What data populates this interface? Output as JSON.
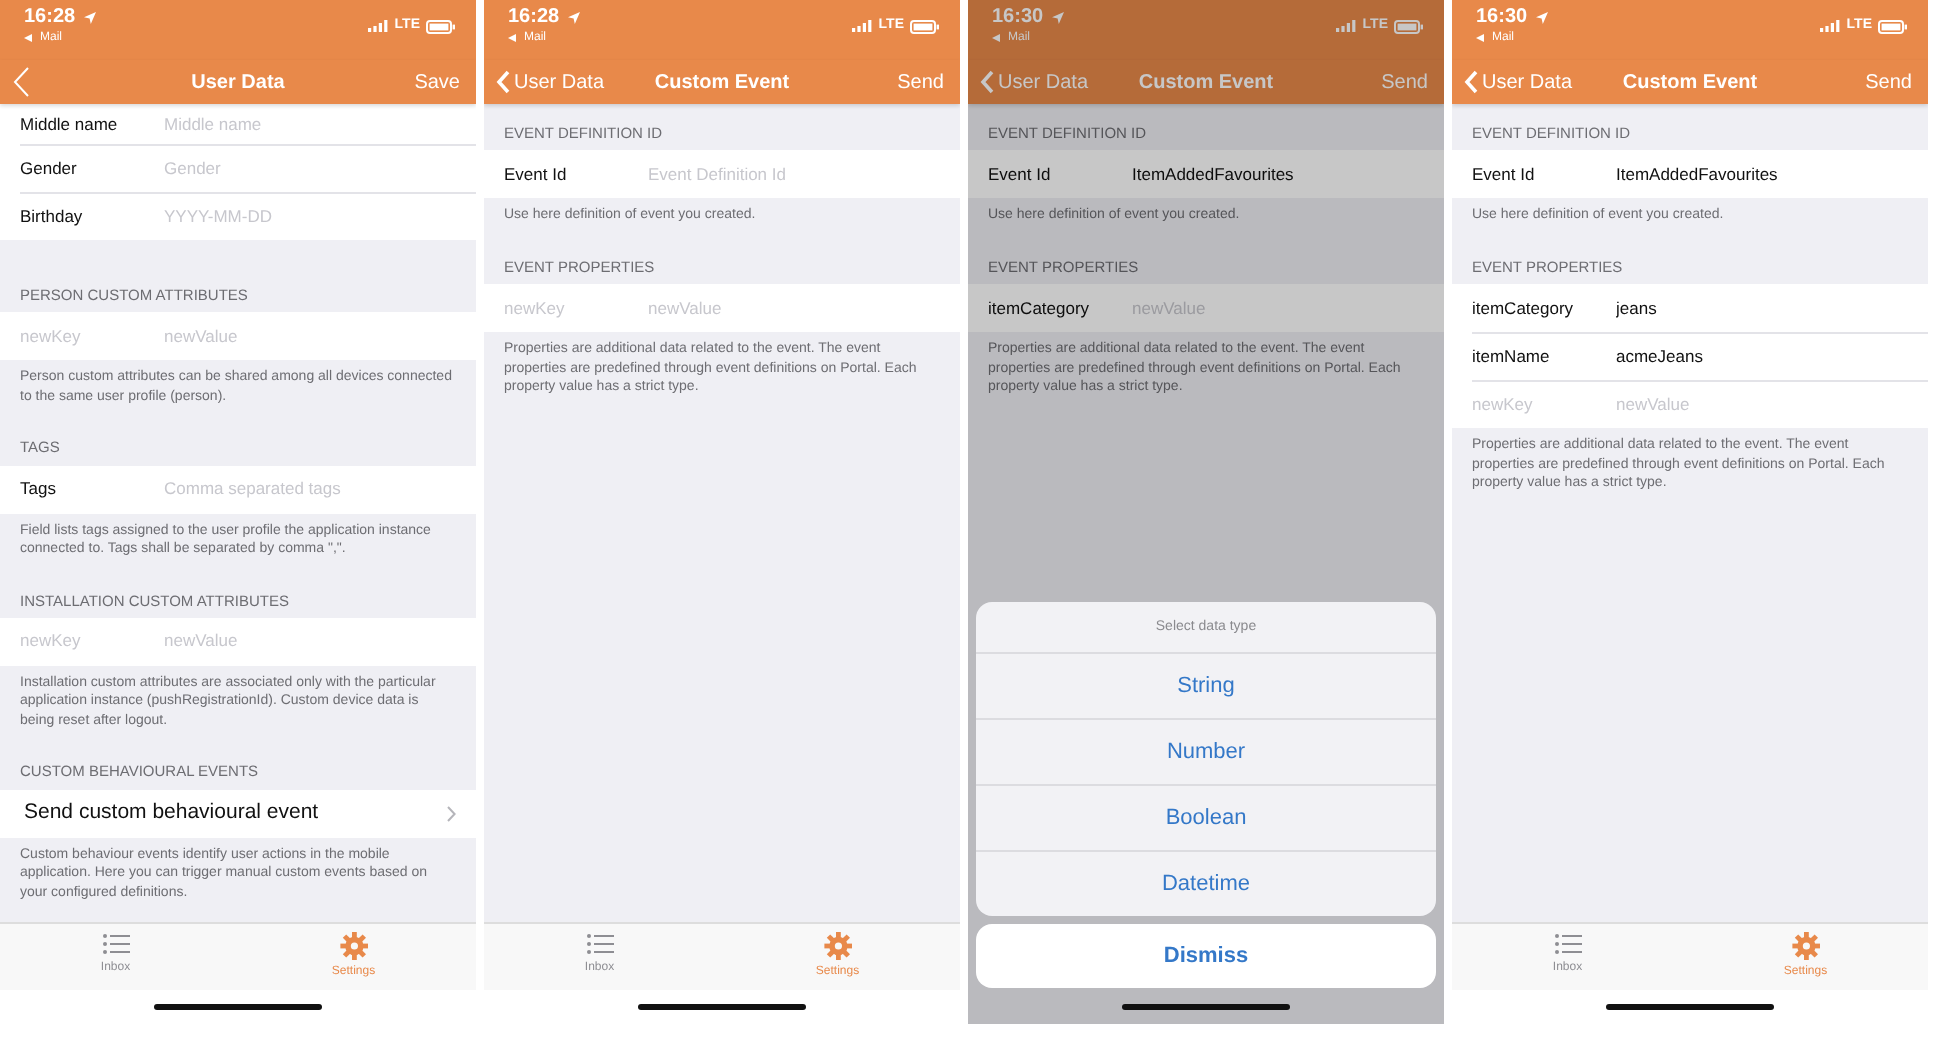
{
  "screens": [
    {
      "status_bar": {
        "time": "16:28",
        "back_app": "Mail",
        "network": "LTE"
      },
      "nav": {
        "title": "User Data",
        "action": "Save"
      },
      "sections": [
        {
          "kind": "field",
          "label": "Middle name",
          "placeholder": "Middle name"
        },
        {
          "kind": "field",
          "label": "Gender",
          "placeholder": "Gender"
        },
        {
          "kind": "field",
          "label": "Birthday",
          "placeholder": "YYYY-MM-DD"
        },
        {
          "kind": "header",
          "text": "PERSON CUSTOM ATTRIBUTES"
        },
        {
          "kind": "pair",
          "key_placeholder": "newKey",
          "placeholder": "newValue"
        },
        {
          "kind": "footer",
          "text": "Person custom attributes can be shared among all devices connected to the same user profile (person)."
        },
        {
          "kind": "header",
          "text": "TAGS"
        },
        {
          "kind": "field",
          "label": "Tags",
          "placeholder": "Comma separated tags"
        },
        {
          "kind": "footer",
          "text": "Field lists tags assigned to the user profile the application instance connected to. Tags shall be separated by comma \",\"."
        },
        {
          "kind": "header",
          "text": "INSTALLATION CUSTOM ATTRIBUTES"
        },
        {
          "kind": "pair",
          "key_placeholder": "newKey",
          "placeholder": "newValue"
        },
        {
          "kind": "footer",
          "text": "Installation custom attributes are associated only with the particular application instance (pushRegistrationId). Custom device data is being reset after logout."
        },
        {
          "kind": "header",
          "text": "CUSTOM BEHAVIOURAL EVENTS"
        },
        {
          "kind": "link",
          "label": "Send custom behavioural event"
        },
        {
          "kind": "footer",
          "text": "Custom behaviour events identify user actions in the mobile application. Here you can trigger manual custom events based on your configured definitions."
        }
      ],
      "tab_bar": [
        {
          "label": "Inbox",
          "selected": false
        },
        {
          "label": "Settings",
          "selected": true
        }
      ]
    },
    {
      "status_bar": {
        "time": "16:28",
        "back_app": "Mail",
        "network": "LTE"
      },
      "nav": {
        "back_label": "User Data",
        "title": "Custom Event",
        "action": "Send"
      },
      "sections": [
        {
          "kind": "header",
          "text": "EVENT DEFINITION ID"
        },
        {
          "kind": "field",
          "label": "Event Id",
          "placeholder": "Event Definition Id"
        },
        {
          "kind": "footer",
          "text": "Use here definition of event you created."
        },
        {
          "kind": "header",
          "text": "EVENT PROPERTIES"
        },
        {
          "kind": "pair",
          "key_placeholder": "newKey",
          "placeholder": "newValue"
        },
        {
          "kind": "footer",
          "text": "Properties are additional data related to the event. The event properties are predefined through event definitions on Portal. Each property value has a strict type."
        }
      ],
      "tab_bar": [
        {
          "label": "Inbox",
          "selected": false
        },
        {
          "label": "Settings",
          "selected": true
        }
      ]
    },
    {
      "status_bar": {
        "time": "16:30",
        "back_app": "Mail",
        "network": "LTE"
      },
      "nav": {
        "back_label": "User Data",
        "title": "Custom Event",
        "action": "Send"
      },
      "sections": [
        {
          "kind": "header",
          "text": "EVENT DEFINITION ID"
        },
        {
          "kind": "field",
          "label": "Event Id",
          "value": "ItemAddedFavourites"
        },
        {
          "kind": "footer",
          "text": "Use here definition of event you created."
        },
        {
          "kind": "header",
          "text": "EVENT PROPERTIES"
        },
        {
          "kind": "pair",
          "key": "itemCategory",
          "placeholder": "newValue"
        },
        {
          "kind": "footer",
          "text": "Properties are additional data related to the event. The event properties are predefined through event definitions on Portal. Each property value has a strict type."
        }
      ],
      "action_sheet": {
        "title": "Select data type",
        "options": [
          "String",
          "Number",
          "Boolean",
          "Datetime"
        ],
        "cancel": "Dismiss"
      }
    },
    {
      "status_bar": {
        "time": "16:30",
        "back_app": "Mail",
        "network": "LTE"
      },
      "nav": {
        "back_label": "User Data",
        "title": "Custom Event",
        "action": "Send"
      },
      "sections": [
        {
          "kind": "header",
          "text": "EVENT DEFINITION ID"
        },
        {
          "kind": "field",
          "label": "Event Id",
          "value": "ItemAddedFavourites"
        },
        {
          "kind": "footer",
          "text": "Use here definition of event you created."
        },
        {
          "kind": "header",
          "text": "EVENT PROPERTIES"
        },
        {
          "kind": "pair",
          "key": "itemCategory",
          "value": "jeans"
        },
        {
          "kind": "pair",
          "key": "itemName",
          "value": "acmeJeans"
        },
        {
          "kind": "pair",
          "key_placeholder": "newKey",
          "placeholder": "newValue"
        },
        {
          "kind": "footer",
          "text": "Properties are additional data related to the event. The event properties are predefined through event definitions on Portal. Each property value has a strict type."
        }
      ],
      "tab_bar": [
        {
          "label": "Inbox",
          "selected": false
        },
        {
          "label": "Settings",
          "selected": true
        }
      ]
    }
  ]
}
